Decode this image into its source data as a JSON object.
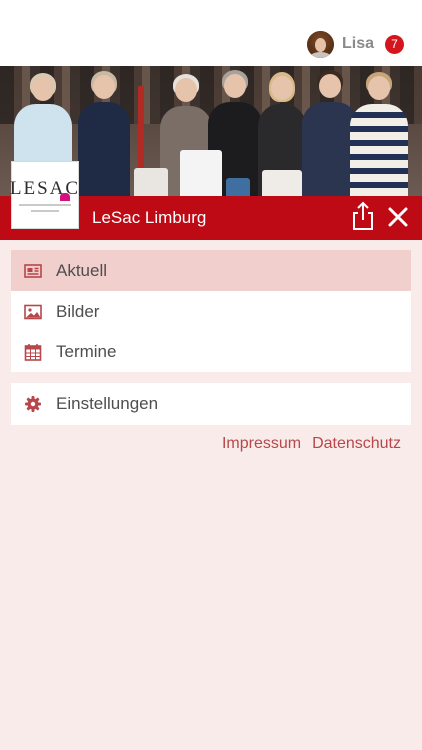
{
  "user": {
    "name": "Lisa",
    "notifications": "7"
  },
  "shop": {
    "name": "LeSac Limburg",
    "logo_text": "LESAC"
  },
  "menu_primary": [
    {
      "label": "Aktuell",
      "icon": "newspaper-icon",
      "active": true
    },
    {
      "label": "Bilder",
      "icon": "image-icon",
      "active": false
    },
    {
      "label": "Termine",
      "icon": "calendar-icon",
      "active": false
    }
  ],
  "menu_secondary": [
    {
      "label": "Einstellungen",
      "icon": "gear-icon"
    }
  ],
  "footer_links": {
    "impressum": "Impressum",
    "datenschutz": "Datenschutz"
  },
  "colors": {
    "brand_red": "#be0a14",
    "accent_text": "#b7474a",
    "background": "#f9ebea",
    "badge_red": "#d5151d",
    "active_row": "#f1cfcd"
  }
}
